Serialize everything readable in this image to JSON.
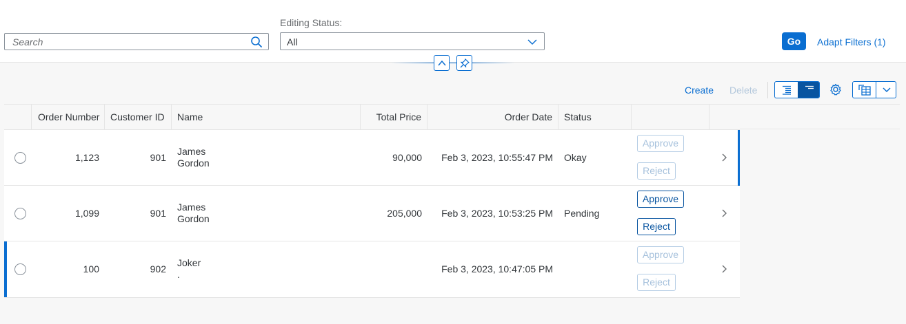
{
  "filter_bar": {
    "search_placeholder": "Search",
    "editing_status_label": "Editing Status:",
    "editing_status_value": "All",
    "go_label": "Go",
    "adapt_filters_label": "Adapt Filters (1)"
  },
  "toolbar": {
    "create_label": "Create",
    "delete_label": "Delete"
  },
  "table": {
    "columns": [
      "Order Number",
      "Customer ID",
      "Name",
      "Total Price",
      "Order Date",
      "Status"
    ],
    "approve_label": "Approve",
    "reject_label": "Reject",
    "rows": [
      {
        "order_number": "1,123",
        "customer_id": "901",
        "name_line1": "James",
        "name_line2": "Gordon",
        "total_price": "90,000",
        "order_date": "Feb 3, 2023, 10:55:47 PM",
        "status": "Okay"
      },
      {
        "order_number": "1,099",
        "customer_id": "901",
        "name_line1": "James",
        "name_line2": "Gordon",
        "total_price": "205,000",
        "order_date": "Feb 3, 2023, 10:53:25 PM",
        "status": "Pending"
      },
      {
        "order_number": "100",
        "customer_id": "902",
        "name_line1": "Joker",
        "name_line2": ".",
        "total_price": "",
        "order_date": "Feb 3, 2023, 10:47:05 PM",
        "status": ""
      }
    ]
  },
  "colors": {
    "accent": "#0a6ed1",
    "accent_dark": "#0854a0",
    "disabled": "#a6c1dc"
  }
}
